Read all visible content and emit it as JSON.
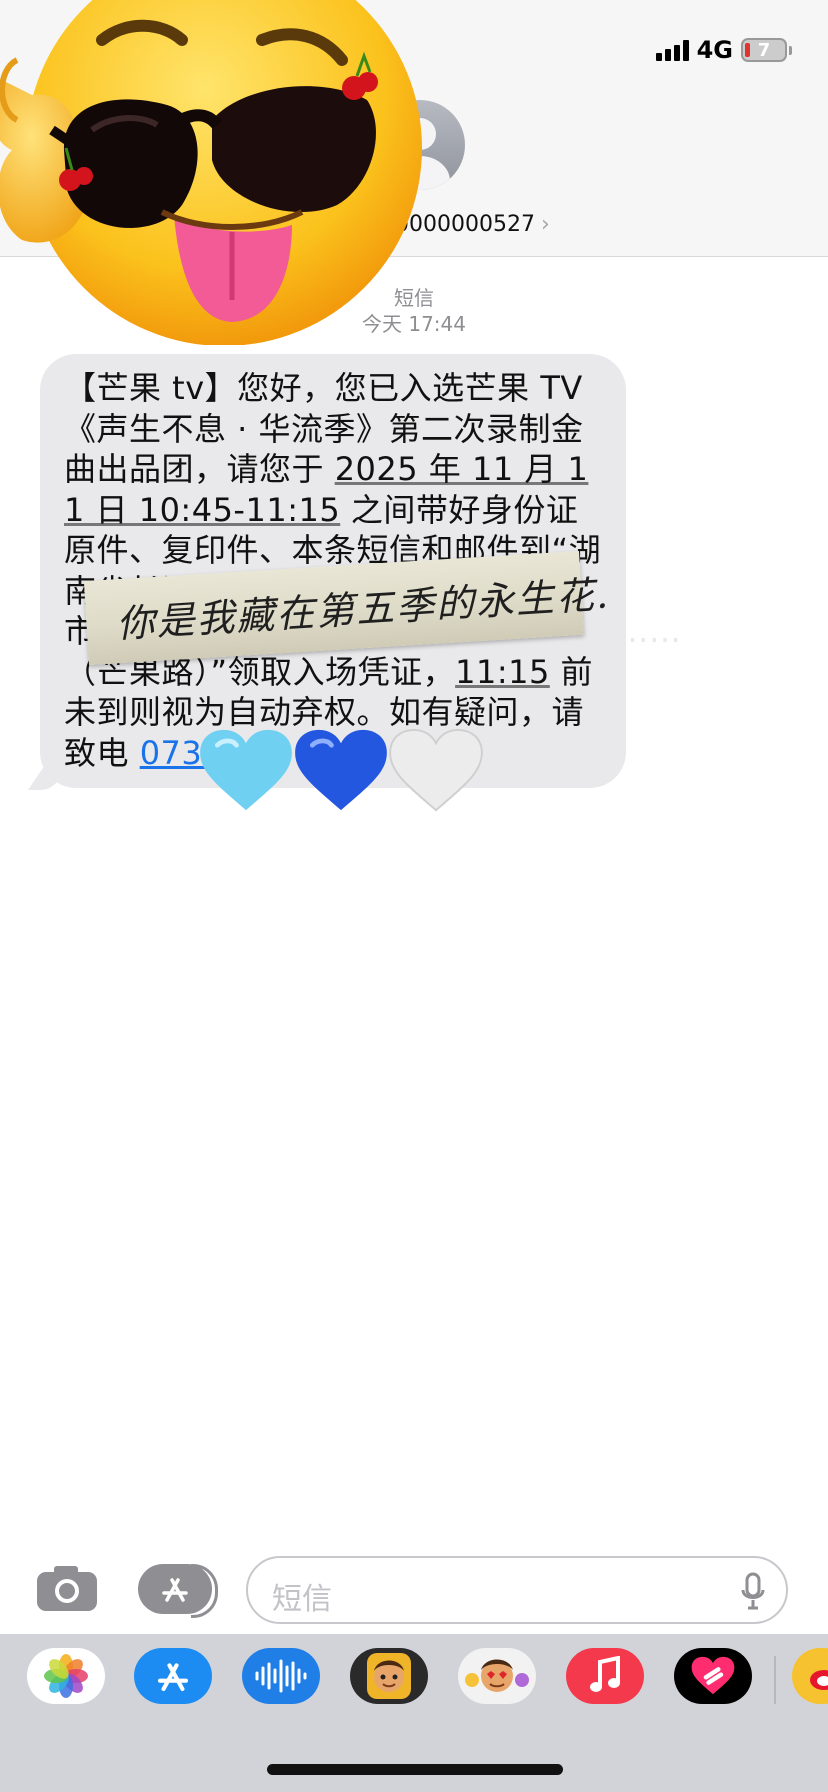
{
  "status_bar": {
    "network": "4G",
    "battery": "7"
  },
  "header": {
    "contact": "0000000527",
    "chevron": "›"
  },
  "thread": {
    "service": "短信",
    "time": "今天 17:44",
    "message": {
      "p1": "【芒果 tv】您好，您已入选芒果 TV《声生不息 · 华流季》第二次录制金曲出品团，请您于 ",
      "date": "2025 年 11 月 11 日 10:45-11:15",
      "p2": " 之间带好身份证原件、复印件、本条短信和邮件到“湖南省长沙市",
      "hidden": "………………………………………………",
      "p3": "（芒果路）”领取入场凭证，",
      "deadline": "11:15",
      "p4": " 前未到则视为自动弃权。如有疑问，请致电 ",
      "phone": "0731"
    }
  },
  "overlay": {
    "handwriting": "你是我藏在第五季的永生花."
  },
  "compose": {
    "placeholder": "短信"
  },
  "colors": {
    "link": "#1a73e8",
    "bubble": "#e9e9eb",
    "accent_blue": "#2f7df6"
  },
  "apps": [
    "photos-app",
    "app-store-app",
    "audio-app",
    "memoji-app",
    "memoji-stickers-app",
    "music-app",
    "heart-app",
    "weibo-app"
  ]
}
